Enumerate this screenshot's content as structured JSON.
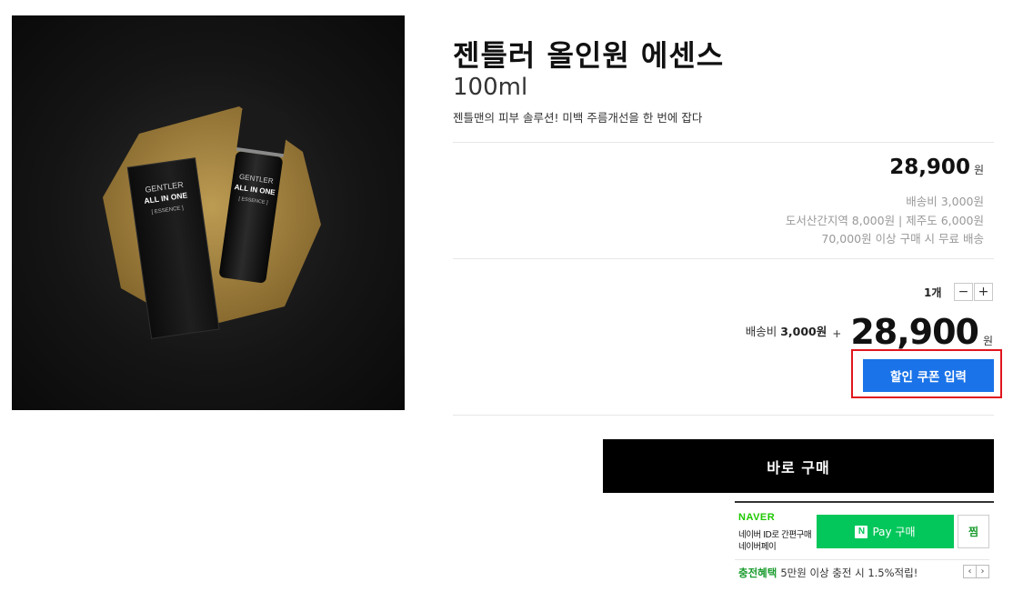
{
  "product": {
    "title": "젠틀러 올인원 에센스",
    "volume": "100ml",
    "description": "젠틀맨의 피부 솔루션! 미백 주름개선을 한 번에 잡다",
    "image": {
      "box_label_1": "GENTLER",
      "box_label_2": "ALL IN ONE",
      "box_label_3": "[ ESSENCE ]",
      "bottle_label_1": "GENTLER",
      "bottle_label_2": "ALL IN ONE",
      "bottle_label_3": "[ ESSENCE ]",
      "colors": {
        "background": "#111111",
        "octagon": "#b08b3c",
        "product": "#141414"
      }
    }
  },
  "price": {
    "value": "28,900",
    "unit": "원"
  },
  "shipping": {
    "fee": "배송비 3,000원",
    "regional": "도서산간지역 8,000원 | 제주도 6,000원",
    "free_condition": "70,000원 이상 구매 시 무료 배송"
  },
  "quantity": {
    "label": "1개",
    "minus": "−",
    "plus": "+"
  },
  "total": {
    "ship_prefix": "배송비 ",
    "ship_amount": "3,000원",
    "plus_sign": "+",
    "value": "28,900",
    "unit": "원"
  },
  "buttons": {
    "coupon": "할인 쿠폰 입력",
    "buy_now": "바로 구매"
  },
  "naver_pay": {
    "brand": "NAVER",
    "sub_line_1": "네이버 ID로 간편구매",
    "sub_line_2": "네이버페이",
    "pay_icon": "N",
    "pay_label": "Pay 구매",
    "zzim": "찜",
    "benefit_label": "충전혜택",
    "benefit_text": "5만원 이상 충전 시 1.5%적립!",
    "prev": "‹",
    "next": "›"
  },
  "colors": {
    "accent_blue": "#1a73e8",
    "highlight_red": "#e0161c",
    "naver_green": "#03c75a"
  }
}
